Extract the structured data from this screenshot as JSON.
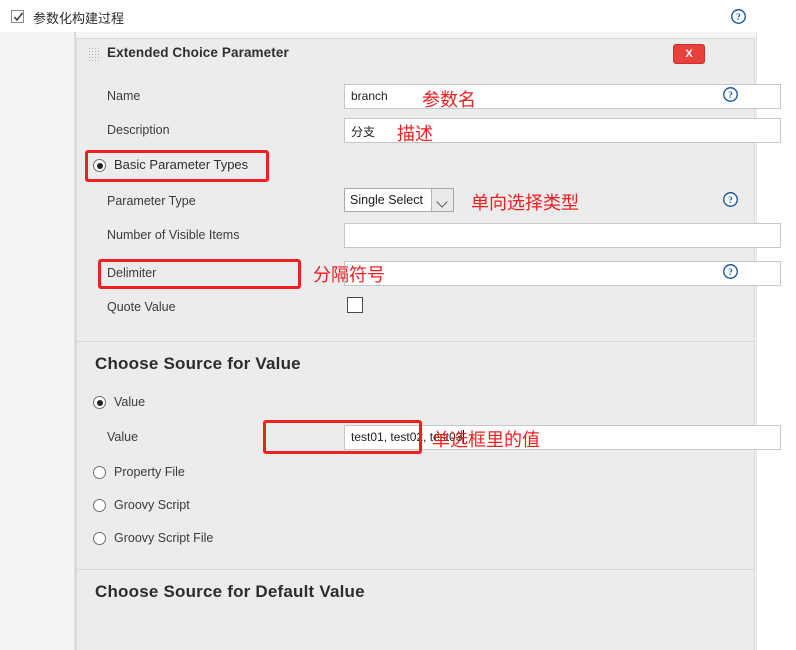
{
  "topbar": {
    "checkbox_checked": true,
    "label": "参数化构建过程",
    "help_icon": "help-circle-icon"
  },
  "panel": {
    "title": "Extended Choice Parameter",
    "grip_icon": "drag-grip-icon",
    "close_label": "X"
  },
  "fields": {
    "name": {
      "label": "Name",
      "value": "branch",
      "annotation": "参数名"
    },
    "description": {
      "label": "Description",
      "value": "分支",
      "annotation": "描述"
    },
    "basic_parameter_types": {
      "label": "Basic Parameter Types",
      "selected": true
    },
    "parameter_type": {
      "label": "Parameter Type",
      "value": "Single Select",
      "annotation": "单向选择类型"
    },
    "number_of_visible_items": {
      "label": "Number of Visible Items",
      "value": ""
    },
    "delimiter": {
      "label": "Delimiter",
      "value": ",",
      "annotation": "分隔符号"
    },
    "quote_value": {
      "label": "Quote Value",
      "checked": false
    }
  },
  "choose_source_value": {
    "heading": "Choose Source for Value",
    "options": [
      {
        "label": "Value",
        "selected": true
      },
      {
        "label": "Property File",
        "selected": false
      },
      {
        "label": "Groovy Script",
        "selected": false
      },
      {
        "label": "Groovy Script File",
        "selected": false
      }
    ],
    "value_field": {
      "label": "Value",
      "value": "test01, test02, test03",
      "annotation": "单选框里的值"
    }
  },
  "choose_source_default": {
    "heading": "Choose Source for Default Value"
  }
}
